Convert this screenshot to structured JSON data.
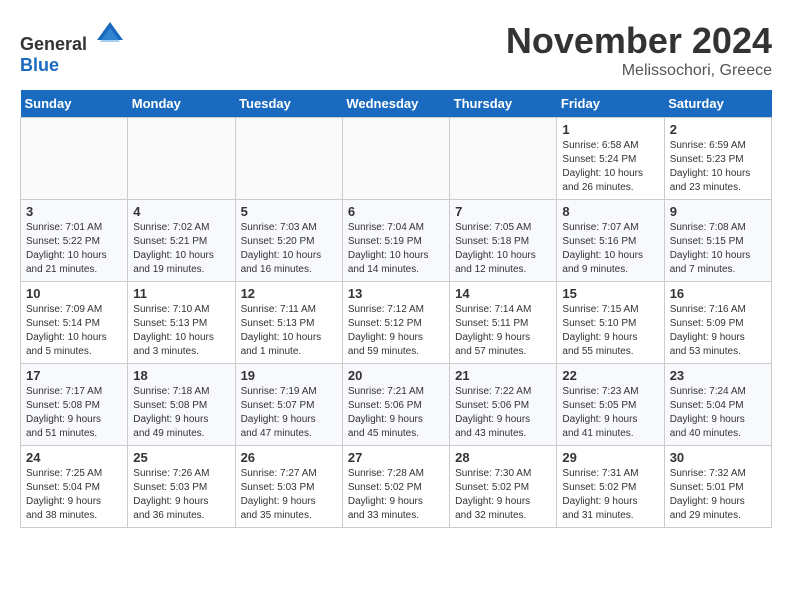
{
  "header": {
    "logo_general": "General",
    "logo_blue": "Blue",
    "month_title": "November 2024",
    "location": "Melissochori, Greece"
  },
  "days_of_week": [
    "Sunday",
    "Monday",
    "Tuesday",
    "Wednesday",
    "Thursday",
    "Friday",
    "Saturday"
  ],
  "weeks": [
    [
      {
        "day": "",
        "info": ""
      },
      {
        "day": "",
        "info": ""
      },
      {
        "day": "",
        "info": ""
      },
      {
        "day": "",
        "info": ""
      },
      {
        "day": "",
        "info": ""
      },
      {
        "day": "1",
        "info": "Sunrise: 6:58 AM\nSunset: 5:24 PM\nDaylight: 10 hours\nand 26 minutes."
      },
      {
        "day": "2",
        "info": "Sunrise: 6:59 AM\nSunset: 5:23 PM\nDaylight: 10 hours\nand 23 minutes."
      }
    ],
    [
      {
        "day": "3",
        "info": "Sunrise: 7:01 AM\nSunset: 5:22 PM\nDaylight: 10 hours\nand 21 minutes."
      },
      {
        "day": "4",
        "info": "Sunrise: 7:02 AM\nSunset: 5:21 PM\nDaylight: 10 hours\nand 19 minutes."
      },
      {
        "day": "5",
        "info": "Sunrise: 7:03 AM\nSunset: 5:20 PM\nDaylight: 10 hours\nand 16 minutes."
      },
      {
        "day": "6",
        "info": "Sunrise: 7:04 AM\nSunset: 5:19 PM\nDaylight: 10 hours\nand 14 minutes."
      },
      {
        "day": "7",
        "info": "Sunrise: 7:05 AM\nSunset: 5:18 PM\nDaylight: 10 hours\nand 12 minutes."
      },
      {
        "day": "8",
        "info": "Sunrise: 7:07 AM\nSunset: 5:16 PM\nDaylight: 10 hours\nand 9 minutes."
      },
      {
        "day": "9",
        "info": "Sunrise: 7:08 AM\nSunset: 5:15 PM\nDaylight: 10 hours\nand 7 minutes."
      }
    ],
    [
      {
        "day": "10",
        "info": "Sunrise: 7:09 AM\nSunset: 5:14 PM\nDaylight: 10 hours\nand 5 minutes."
      },
      {
        "day": "11",
        "info": "Sunrise: 7:10 AM\nSunset: 5:13 PM\nDaylight: 10 hours\nand 3 minutes."
      },
      {
        "day": "12",
        "info": "Sunrise: 7:11 AM\nSunset: 5:13 PM\nDaylight: 10 hours\nand 1 minute."
      },
      {
        "day": "13",
        "info": "Sunrise: 7:12 AM\nSunset: 5:12 PM\nDaylight: 9 hours\nand 59 minutes."
      },
      {
        "day": "14",
        "info": "Sunrise: 7:14 AM\nSunset: 5:11 PM\nDaylight: 9 hours\nand 57 minutes."
      },
      {
        "day": "15",
        "info": "Sunrise: 7:15 AM\nSunset: 5:10 PM\nDaylight: 9 hours\nand 55 minutes."
      },
      {
        "day": "16",
        "info": "Sunrise: 7:16 AM\nSunset: 5:09 PM\nDaylight: 9 hours\nand 53 minutes."
      }
    ],
    [
      {
        "day": "17",
        "info": "Sunrise: 7:17 AM\nSunset: 5:08 PM\nDaylight: 9 hours\nand 51 minutes."
      },
      {
        "day": "18",
        "info": "Sunrise: 7:18 AM\nSunset: 5:08 PM\nDaylight: 9 hours\nand 49 minutes."
      },
      {
        "day": "19",
        "info": "Sunrise: 7:19 AM\nSunset: 5:07 PM\nDaylight: 9 hours\nand 47 minutes."
      },
      {
        "day": "20",
        "info": "Sunrise: 7:21 AM\nSunset: 5:06 PM\nDaylight: 9 hours\nand 45 minutes."
      },
      {
        "day": "21",
        "info": "Sunrise: 7:22 AM\nSunset: 5:06 PM\nDaylight: 9 hours\nand 43 minutes."
      },
      {
        "day": "22",
        "info": "Sunrise: 7:23 AM\nSunset: 5:05 PM\nDaylight: 9 hours\nand 41 minutes."
      },
      {
        "day": "23",
        "info": "Sunrise: 7:24 AM\nSunset: 5:04 PM\nDaylight: 9 hours\nand 40 minutes."
      }
    ],
    [
      {
        "day": "24",
        "info": "Sunrise: 7:25 AM\nSunset: 5:04 PM\nDaylight: 9 hours\nand 38 minutes."
      },
      {
        "day": "25",
        "info": "Sunrise: 7:26 AM\nSunset: 5:03 PM\nDaylight: 9 hours\nand 36 minutes."
      },
      {
        "day": "26",
        "info": "Sunrise: 7:27 AM\nSunset: 5:03 PM\nDaylight: 9 hours\nand 35 minutes."
      },
      {
        "day": "27",
        "info": "Sunrise: 7:28 AM\nSunset: 5:02 PM\nDaylight: 9 hours\nand 33 minutes."
      },
      {
        "day": "28",
        "info": "Sunrise: 7:30 AM\nSunset: 5:02 PM\nDaylight: 9 hours\nand 32 minutes."
      },
      {
        "day": "29",
        "info": "Sunrise: 7:31 AM\nSunset: 5:02 PM\nDaylight: 9 hours\nand 31 minutes."
      },
      {
        "day": "30",
        "info": "Sunrise: 7:32 AM\nSunset: 5:01 PM\nDaylight: 9 hours\nand 29 minutes."
      }
    ]
  ]
}
